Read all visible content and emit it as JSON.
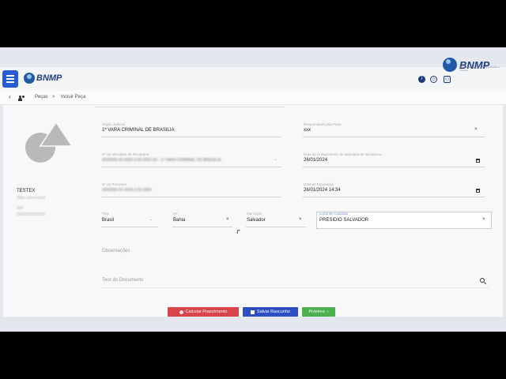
{
  "header": {
    "logo_text": "BNMP",
    "corner_logo_text": "BNMP",
    "corner_logo_sub": "Banco Nacional de Medidas Penais e Prisões"
  },
  "breadcrumb": {
    "items": [
      "Peças",
      "Incluir Peça"
    ],
    "separator": ">"
  },
  "person": {
    "name": "TESTEX",
    "line1": "(Não Informado)",
    "line2": "000",
    "line3": "0000000000000"
  },
  "form": {
    "orgao": {
      "label": "Órgão Judicial",
      "value": "1ª VARA CRIMINAL DE BRASILIA"
    },
    "responsavel": {
      "label": "Responsável pela Peça",
      "value": "xxx"
    },
    "mandado": {
      "label": "Nº do Mandado de Recaptura",
      "value": "0000000-00.0000.0.00.0000.00 - 1ª VARA CRIMINAL DE BRASILIA"
    },
    "data_cumprimento": {
      "label": "Data de Cumprimento do Mandado de Recaptura",
      "value": "26/01/2024"
    },
    "processo": {
      "label": "Nº do Processo",
      "value": "0000000-00.0000.0.00.0000"
    },
    "data_expedicao": {
      "label": "Data de Expedição",
      "value": "26/01/2024 14:34"
    },
    "pais": {
      "label": "País",
      "value": "Brasil"
    },
    "uf": {
      "label": "UF",
      "value": "Bahia"
    },
    "municipio": {
      "label": "Município",
      "value": "Salvador"
    },
    "local_custodia": {
      "label": "Local de Custódia",
      "value": "PRESIDIO SALVADOR"
    },
    "observacoes_label": "Observações",
    "teor_label": "Teor do Documento"
  },
  "actions": {
    "calcular": "Calcular Prazo/mento",
    "salvar": "Salvar Rascunho",
    "proximo": "Próximo"
  },
  "colors": {
    "menu": "#2a5bd7",
    "brand": "#1f3f80",
    "btn_red": "#d9434a",
    "btn_blue": "#2c4fc4",
    "btn_green": "#4caf50"
  }
}
